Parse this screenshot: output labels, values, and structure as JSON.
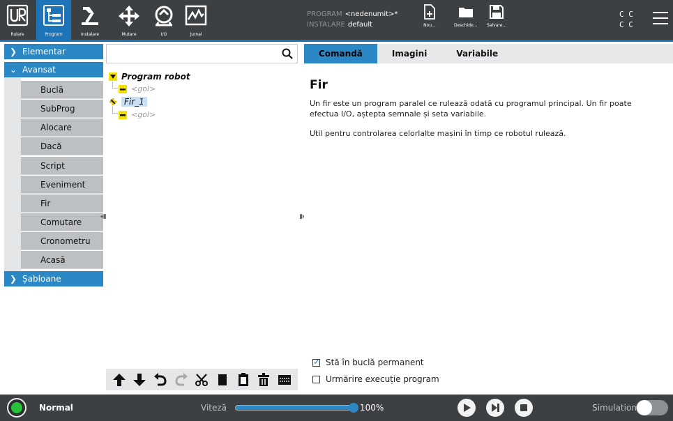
{
  "topbar": {
    "nav": [
      {
        "label": "Rulare",
        "icon": "ur-logo-icon"
      },
      {
        "label": "Program",
        "icon": "program-icon",
        "active": true
      },
      {
        "label": "Instalare",
        "icon": "installation-icon"
      },
      {
        "label": "Mutare",
        "icon": "move-icon"
      },
      {
        "label": "I/O",
        "icon": "io-icon"
      },
      {
        "label": "Jurnal",
        "icon": "log-icon"
      }
    ],
    "program_label": "PROGRAM",
    "program_value": "<nedenumit>*",
    "install_label": "INSTALARE",
    "install_value": "default",
    "file_buttons": [
      {
        "label": "Nou...",
        "icon": "new-file-icon"
      },
      {
        "label": "Deschide...",
        "icon": "open-folder-icon"
      },
      {
        "label": "Salvare...",
        "icon": "save-icon"
      }
    ],
    "cc_row1": "C C",
    "cc_row2": "C C",
    "accent_color": "#1e74b8"
  },
  "left_panel": {
    "categories": [
      {
        "label": "Elementar",
        "expanded": false
      },
      {
        "label": "Avansat",
        "expanded": true
      },
      {
        "label": "Șabloane",
        "expanded": false
      }
    ],
    "commands": [
      "Buclă",
      "SubProg",
      "Alocare",
      "Dacă",
      "Script",
      "Eveniment",
      "Fir",
      "Comutare",
      "Cronometru",
      "Acasă"
    ]
  },
  "tree": {
    "search_placeholder": "",
    "nodes": [
      {
        "label": "Program robot",
        "kind": "root"
      },
      {
        "label": "<gol>",
        "kind": "empty"
      },
      {
        "label": "Fir_1",
        "kind": "thread",
        "selected": true
      },
      {
        "label": "<gol>",
        "kind": "empty"
      }
    ],
    "toolbar_icons": [
      "move-up-icon",
      "move-down-icon",
      "undo-icon",
      "redo-icon",
      "cut-icon",
      "copy-icon",
      "paste-icon",
      "delete-icon",
      "suppress-icon"
    ]
  },
  "right_panel": {
    "tabs": [
      "Comandă",
      "Imagini",
      "Variabile"
    ],
    "active_tab": "Comandă",
    "title": "Fir",
    "description": "Un fir este un program paralel ce rulează odată cu programul principal. Un fir poate efectua I/O, aștepta semnale și seta variabile.",
    "description2": "Util pentru controlarea celorlalte mașini în timp ce robotul rulează.",
    "checkbox_loop": {
      "label": "Stă în buclă permanent",
      "checked": true
    },
    "checkbox_trace": {
      "label": "Urmărire execuție program",
      "checked": false
    }
  },
  "bottombar": {
    "status": "Normal",
    "status_color": "#27c23a",
    "speed_label": "Viteză",
    "speed_value": "100%",
    "speed_fraction": 1.0,
    "simulation_label": "Simulation",
    "simulation_on": false
  }
}
